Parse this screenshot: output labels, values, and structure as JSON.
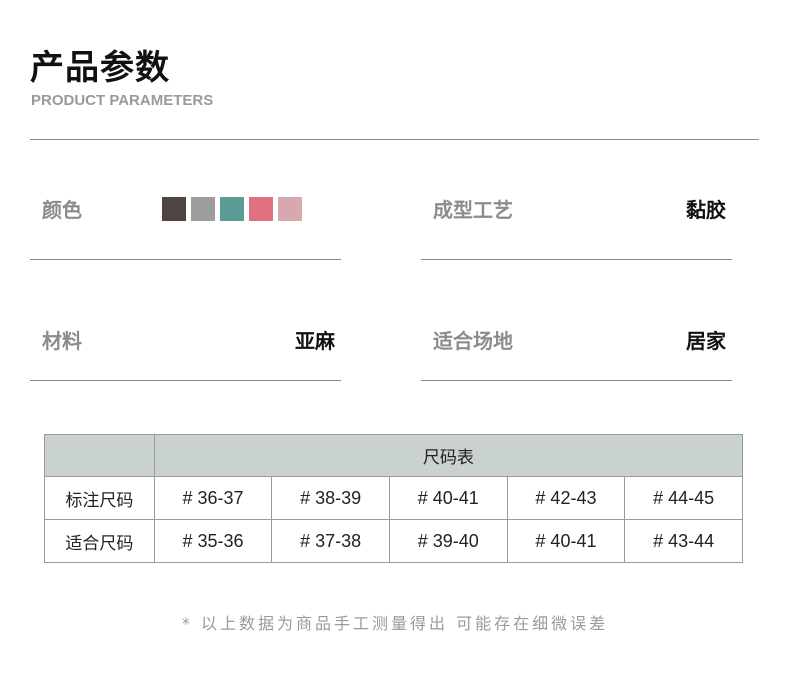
{
  "header": {
    "title": "产品参数",
    "subtitle": "PRODUCT PARAMETERS"
  },
  "params": {
    "color": {
      "label": "颜色",
      "swatches": [
        "#4e4543",
        "#9d9d9f",
        "#5a9b96",
        "#e07180",
        "#d7a9af"
      ]
    },
    "molding": {
      "label": "成型工艺",
      "value": "黏胶"
    },
    "material": {
      "label": "材料",
      "value": "亚麻"
    },
    "occasion": {
      "label": "适合场地",
      "value": "居家"
    }
  },
  "size_table": {
    "title": "尺码表",
    "rows": [
      {
        "label": "标注尺码",
        "values": [
          "# 36-37",
          "# 38-39",
          "# 40-41",
          "# 42-43",
          "# 44-45"
        ]
      },
      {
        "label": "适合尺码",
        "values": [
          "# 35-36",
          "# 37-38",
          "# 39-40",
          "# 40-41",
          "# 43-44"
        ]
      }
    ]
  },
  "footnote": "* 以上数据为商品手工测量得出 可能存在细微误差"
}
